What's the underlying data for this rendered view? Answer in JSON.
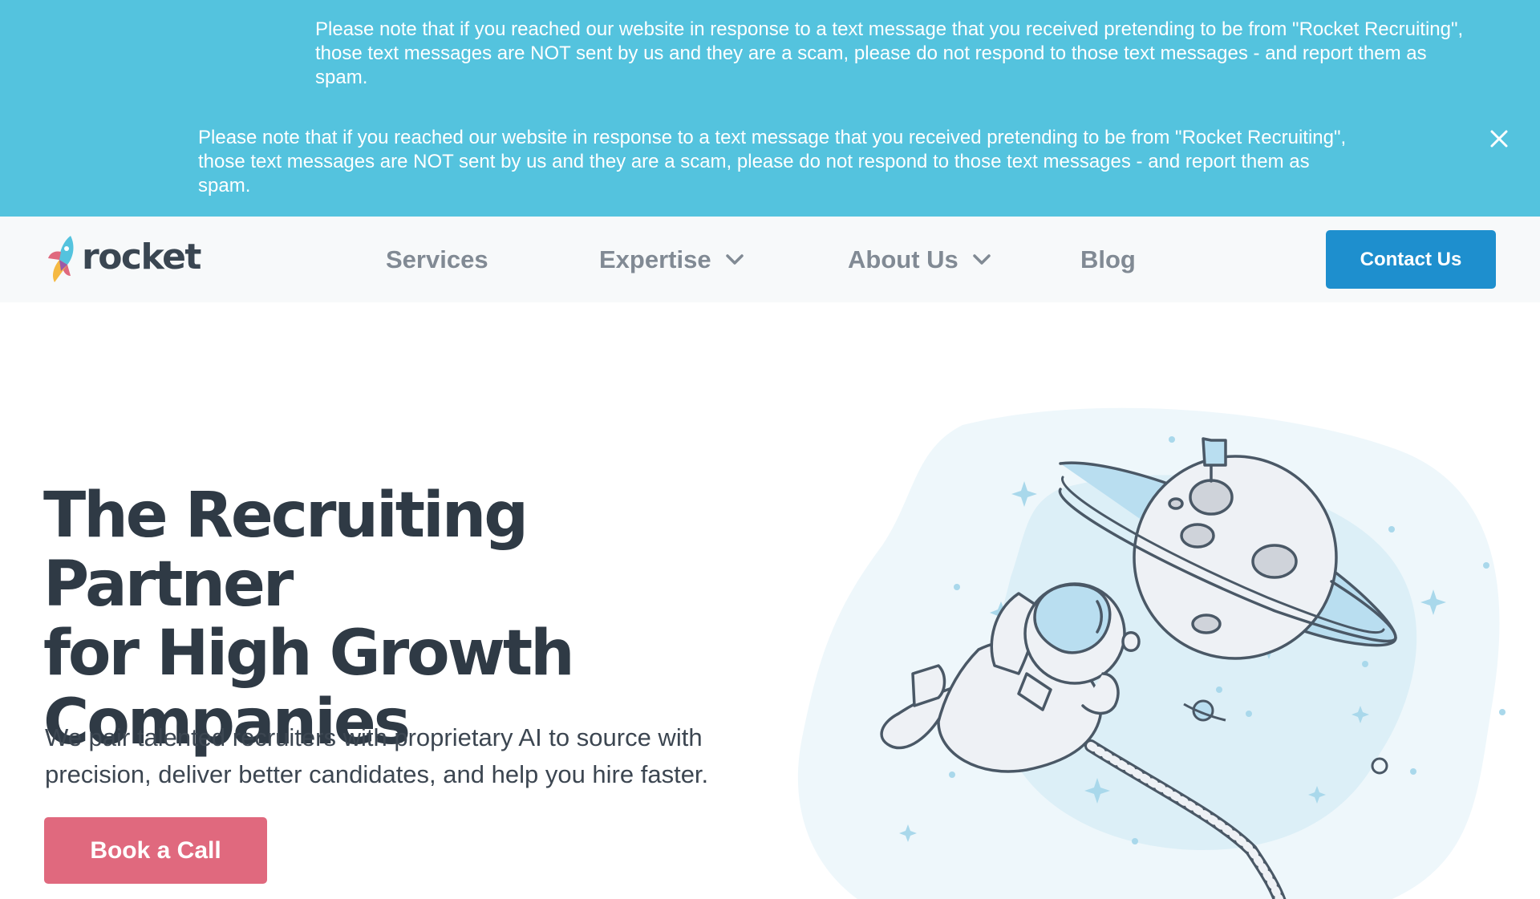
{
  "banner": {
    "notice_primary": "Please note that if you reached our website in response to a text message that you received pretending to be from \"Rocket Recruiting\", those text messages are NOT sent by us and they are a scam, please do not respond to those text messages - and report them as spam.",
    "notice_secondary": "Please note that if you reached our website in response to a text message that you received pretending to be from \"Rocket Recruiting\", those text messages are NOT sent by us and they are a scam, please do not respond to those text messages - and report them as spam.",
    "close_icon": "close-icon",
    "background_color": "#54c3de"
  },
  "nav": {
    "logo_text": "rocket",
    "items": [
      {
        "label": "Services",
        "has_dropdown": false
      },
      {
        "label": "Expertise",
        "has_dropdown": true
      },
      {
        "label": "About Us",
        "has_dropdown": true
      },
      {
        "label": "Blog",
        "has_dropdown": false
      }
    ],
    "contact_label": "Contact Us",
    "contact_color": "#1e8fce"
  },
  "hero": {
    "title_line1": "The Recruiting Partner",
    "title_line2": "for High Growth",
    "title_line3": "Companies",
    "subtitle_line1": "We pair talented recruiters with proprietary AI to source with",
    "subtitle_line2": "precision, deliver better candidates, and help you hire faster.",
    "cta_label": "Book a Call",
    "cta_color": "#e0697e",
    "illustration": "astronaut-planet-illustration"
  }
}
